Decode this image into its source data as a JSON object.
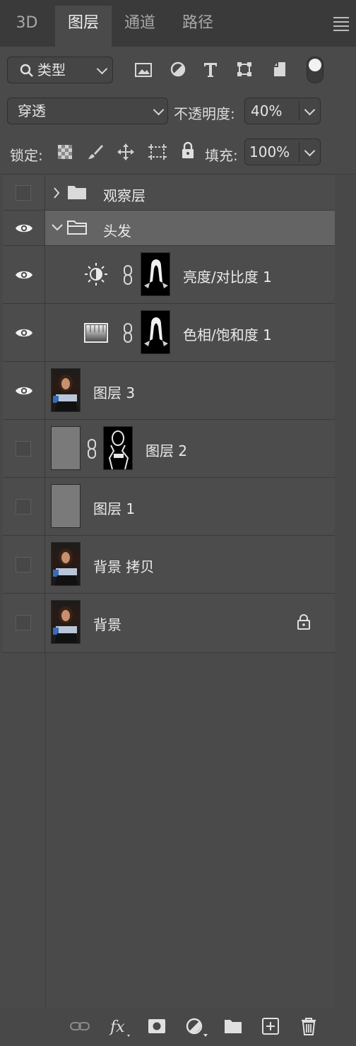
{
  "tabs": [
    "3D",
    "图层",
    "通道",
    "路径"
  ],
  "active_tab": "图层",
  "filter": {
    "label": "类型"
  },
  "blend": {
    "mode": "穿透",
    "opacity_label": "不透明度:",
    "opacity_value": "40%"
  },
  "lock": {
    "label": "锁定:",
    "fill_label": "填充:",
    "fill_value": "100%"
  },
  "layers": [
    {
      "name": "观察层",
      "kind": "group",
      "visible": false,
      "expanded": false
    },
    {
      "name": "头发",
      "kind": "group",
      "visible": true,
      "expanded": true,
      "selected": true
    },
    {
      "name": "亮度/对比度 1",
      "kind": "adjustment-brightness",
      "visible": true
    },
    {
      "name": "色相/饱和度 1",
      "kind": "adjustment-hue",
      "visible": true
    },
    {
      "name": "图层 3",
      "kind": "pixel",
      "visible": true
    },
    {
      "name": "图层 2",
      "kind": "pixel-mask",
      "visible": false
    },
    {
      "name": "图层 1",
      "kind": "pixel",
      "visible": false
    },
    {
      "name": "背景 拷贝",
      "kind": "pixel",
      "visible": false
    },
    {
      "name": "背景",
      "kind": "background",
      "visible": false,
      "locked": true
    }
  ],
  "bottom_icons": [
    "link-layers-icon",
    "fx-icon",
    "add-mask-icon",
    "adjustment-layer-icon",
    "new-group-icon",
    "new-layer-icon",
    "delete-icon"
  ],
  "colors": {
    "panel": "#484848",
    "tabbar": "#3a3a3a",
    "selected_row": "#646464",
    "text": "#eaeaea"
  }
}
